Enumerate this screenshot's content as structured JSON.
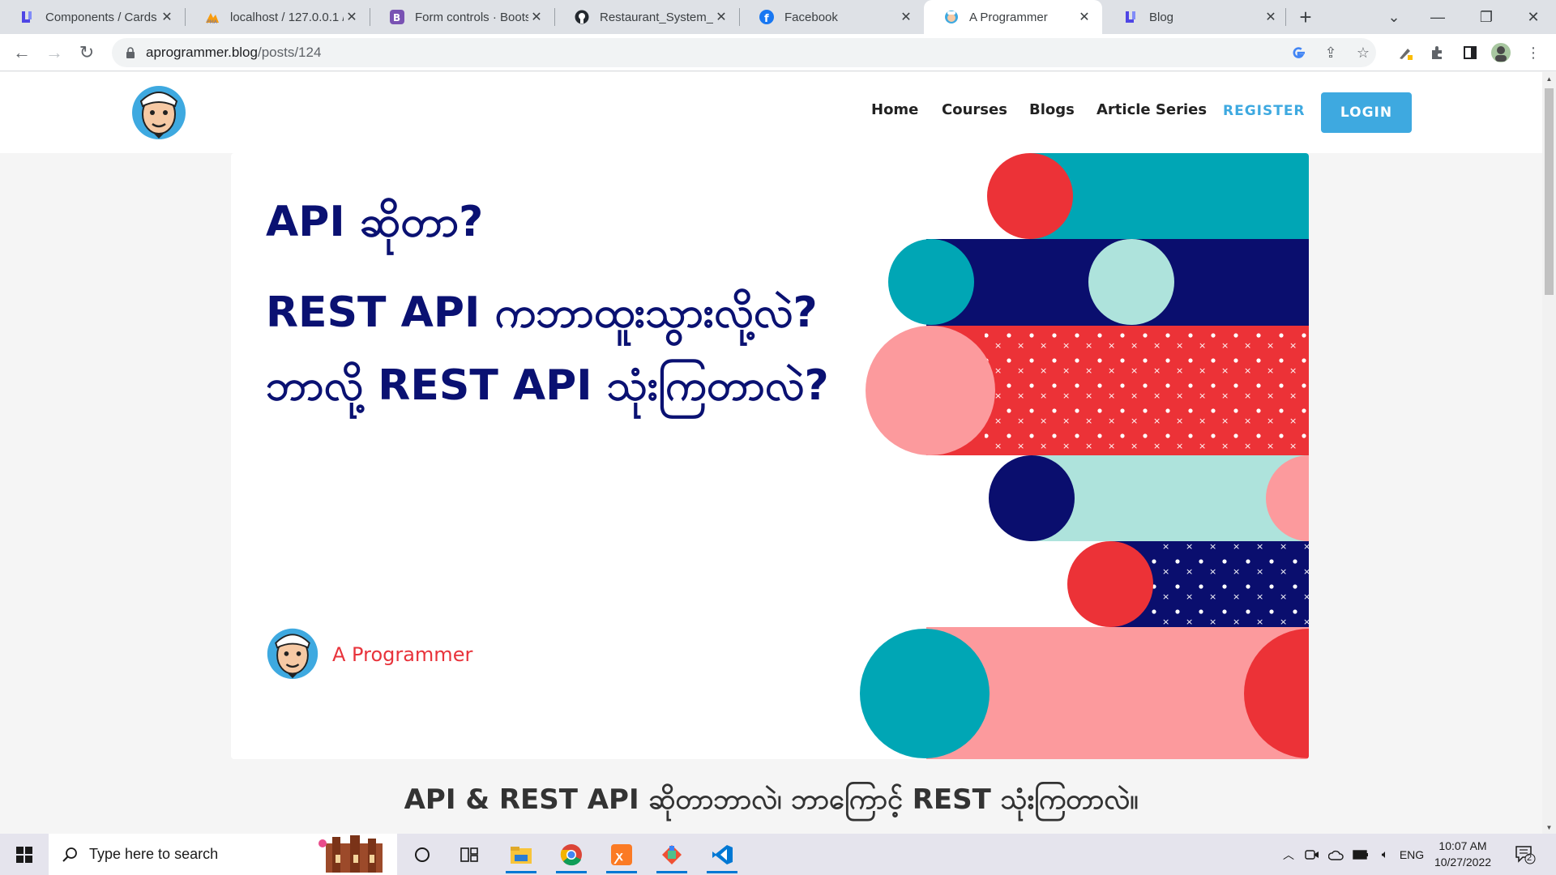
{
  "browser": {
    "tabs": [
      {
        "title": "Components / Cards",
        "icon": "laravel-style-logo-icon",
        "active": false
      },
      {
        "title": "localhost / 127.0.0.1 /",
        "icon": "phpmyadmin-icon",
        "active": false
      },
      {
        "title": "Form controls · Boots",
        "icon": "bootstrap-icon",
        "active": false
      },
      {
        "title": "Restaurant_System_La",
        "icon": "github-icon",
        "active": false
      },
      {
        "title": "Facebook",
        "icon": "facebook-icon",
        "active": false
      },
      {
        "title": "A Programmer",
        "icon": "aprogrammer-favicon-icon",
        "active": true
      },
      {
        "title": "Blog",
        "icon": "laravel-style-logo-icon",
        "active": false
      }
    ],
    "new_tab_label": "+",
    "url_host": "aprogrammer.blog",
    "url_path": "/posts/124"
  },
  "site": {
    "nav": [
      "Home",
      "Courses",
      "Blogs",
      "Article Series"
    ],
    "register_label": "REGISTER",
    "login_label": "LOGIN"
  },
  "hero": {
    "lines": [
      "API ဆိုတာ?",
      "REST API ကဘာထူးသွားလို့လဲ?",
      "ဘာလို့ REST API သုံးကြတာလဲ?"
    ],
    "author": "A Programmer",
    "colors": {
      "navy": "#0a0e6e",
      "teal": "#00a6b5",
      "mint": "#aee3dc",
      "red": "#ec3237",
      "pink": "#fc9a9d",
      "title": "#0a1172"
    }
  },
  "post": {
    "title": "API & REST API ဆိုတာဘာလဲ၊ ဘာကြောင့် REST သုံးကြတာလဲ။"
  },
  "taskbar": {
    "search_placeholder": "Type here to search",
    "language": "ENG",
    "time": "10:07 AM",
    "date": "10/27/2022",
    "notification_count": "2"
  }
}
